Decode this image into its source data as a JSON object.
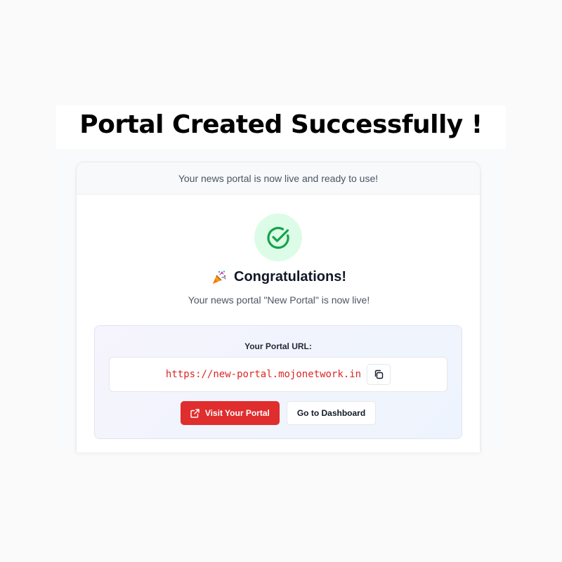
{
  "headline": "Portal Created Successfully !",
  "card": {
    "header_text": "Your news portal is now live and ready to use!",
    "success_icon": "check-circle-icon",
    "congrats_icon": "party-popper-icon",
    "congrats_title": "Congratulations!",
    "subtitle": "Your news portal \"New Portal\" is now live!"
  },
  "url_panel": {
    "label": "Your Portal URL:",
    "url": "https://new-portal.mojonetwork.in",
    "copy_icon": "copy-icon"
  },
  "actions": {
    "visit_label": "Visit Your Portal",
    "visit_icon": "external-link-icon",
    "dashboard_label": "Go to Dashboard"
  },
  "colors": {
    "brand_red": "#e02d2d",
    "success_green": "#16a34a",
    "success_bg": "#dcfce7",
    "url_red": "#dc2626"
  }
}
